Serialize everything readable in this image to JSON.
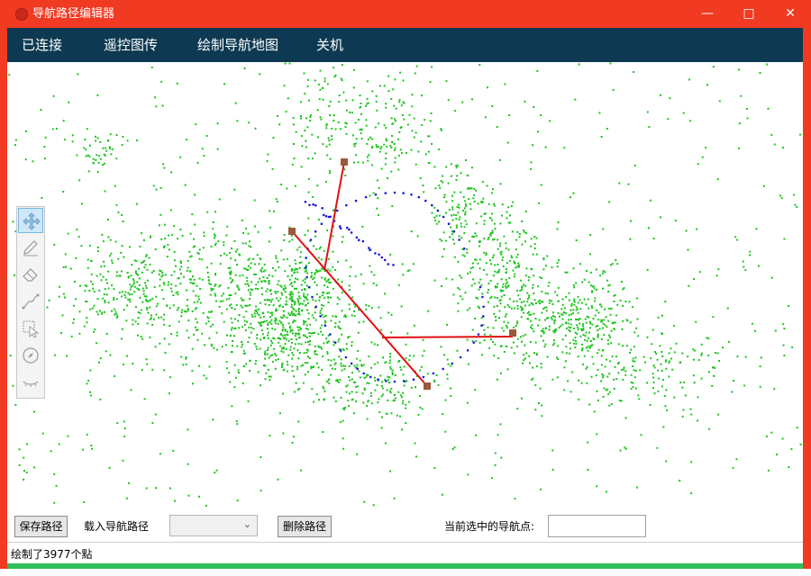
{
  "window": {
    "title": "导航路径编辑器",
    "minimize_icon": "minimize-icon",
    "maximize_icon": "maximize-icon",
    "close_icon": "close-icon",
    "accent": "#f03a22"
  },
  "menu": {
    "items": [
      "已连接",
      "遥控图传",
      "绘制导航地图",
      "关机"
    ],
    "background": "#0d3a52"
  },
  "toolbox": {
    "tools": [
      "move-icon",
      "pencil-icon",
      "eraser-icon",
      "path-draw-icon",
      "select-icon",
      "compass-icon",
      "eye-icon"
    ],
    "active_tool": "move-icon"
  },
  "map": {
    "point_color": "#1bc41b",
    "trajectory_color": "#1a1ad8",
    "path_color": "#e01010",
    "waypoint_color": "#9a5a3a"
  },
  "bottom": {
    "save_label": "保存路径",
    "load_label": "载入导航路径",
    "combo_value": "",
    "delete_label": "删除路径",
    "selected_label": "当前选中的导航点:",
    "selected_value": ""
  },
  "status": {
    "text": "绘制了3977个點"
  }
}
